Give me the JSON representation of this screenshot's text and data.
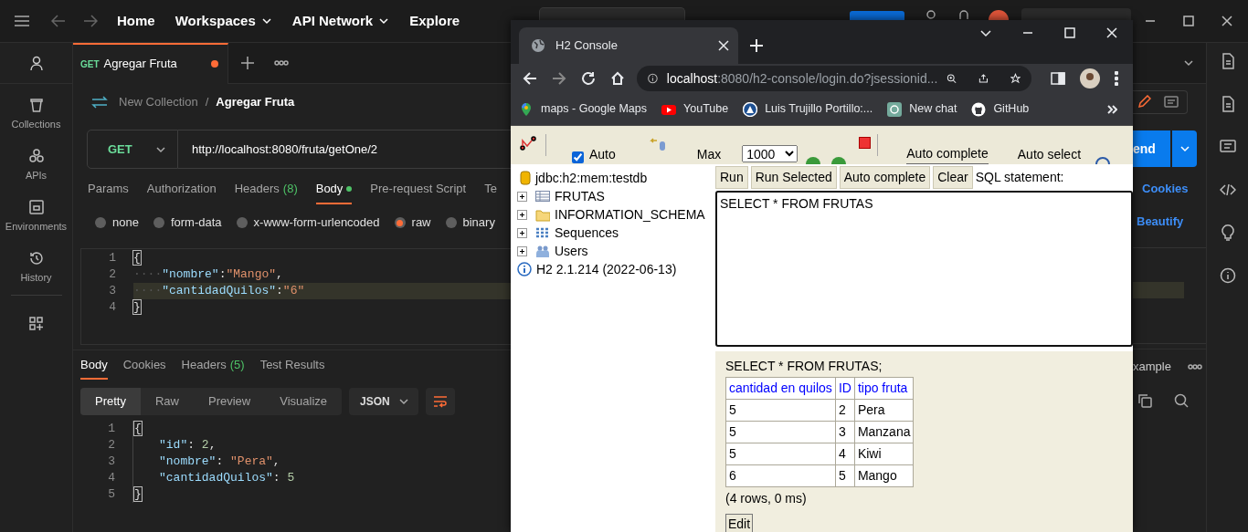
{
  "app_bar": {
    "nav": [
      {
        "label": "Home",
        "dropdown": false
      },
      {
        "label": "Workspaces",
        "dropdown": true
      },
      {
        "label": "API Network",
        "dropdown": true
      },
      {
        "label": "Explore",
        "dropdown": false
      }
    ]
  },
  "sidebar": [
    {
      "kind": "account"
    },
    {
      "kind": "collections",
      "label": "Collections"
    },
    {
      "kind": "apis",
      "label": "APIs"
    },
    {
      "kind": "environments",
      "label": "Environments"
    },
    {
      "kind": "history",
      "label": "History"
    },
    {
      "kind": "add-apps"
    }
  ],
  "request_tab": {
    "method": "GET",
    "title": "Agregar Fruta",
    "unsaved": true
  },
  "breadcrumb": {
    "collection": "New Collection",
    "separator": "/",
    "request": "Agregar Fruta"
  },
  "request": {
    "method": "GET",
    "url": "http://localhost:8080/fruta/getOne/2",
    "send_label": "end"
  },
  "request_tabs": [
    {
      "label": "Params",
      "selected": false
    },
    {
      "label": "Authorization",
      "selected": false
    },
    {
      "label": "Headers",
      "count": "(8)",
      "selected": false
    },
    {
      "label": "Body",
      "selected": true,
      "has_content": true
    },
    {
      "label": "Pre-request Script",
      "selected": false
    },
    {
      "label": "Te",
      "selected": false
    }
  ],
  "cookies_link": "Cookies",
  "body_types": [
    {
      "label": "none",
      "selected": false
    },
    {
      "label": "form-data",
      "selected": false
    },
    {
      "label": "x-www-form-urlencoded",
      "selected": false
    },
    {
      "label": "raw",
      "selected": true
    },
    {
      "label": "binary",
      "selected": false
    }
  ],
  "beautify_link": "Beautify",
  "request_body": [
    {
      "n": "1",
      "current": false,
      "tokens": [
        {
          "kind": "brace",
          "text": "{"
        }
      ]
    },
    {
      "n": "2",
      "current": false,
      "tokens": [
        {
          "kind": "ws",
          "text": "····"
        },
        {
          "kind": "key",
          "text": "\"nombre\""
        },
        {
          "kind": "punct",
          "text": ":"
        },
        {
          "kind": "str",
          "text": "\"Mango\""
        },
        {
          "kind": "punct",
          "text": ","
        }
      ]
    },
    {
      "n": "3",
      "current": true,
      "tokens": [
        {
          "kind": "ws",
          "text": "····"
        },
        {
          "kind": "key",
          "text": "\"cantidadQuilos\""
        },
        {
          "kind": "punct",
          "text": ":"
        },
        {
          "kind": "str",
          "text": "\"6\""
        }
      ]
    },
    {
      "n": "4",
      "current": false,
      "tokens": [
        {
          "kind": "brace",
          "text": "}"
        }
      ]
    }
  ],
  "response_tabs": [
    {
      "label": "Body",
      "selected": true
    },
    {
      "label": "Cookies",
      "selected": false
    },
    {
      "label": "Headers",
      "count": "(5)",
      "selected": false
    },
    {
      "label": "Test Results",
      "selected": false
    }
  ],
  "view_modes": [
    {
      "label": "Pretty",
      "selected": true
    },
    {
      "label": "Raw",
      "selected": false
    },
    {
      "label": "Preview",
      "selected": false
    },
    {
      "label": "Visualize",
      "selected": false
    }
  ],
  "format": "JSON",
  "save_example": "xample",
  "response_body": [
    {
      "n": "1",
      "indented": false,
      "tokens": [
        {
          "kind": "brace",
          "text": "{"
        }
      ]
    },
    {
      "n": "2",
      "indented": true,
      "tokens": [
        {
          "kind": "key",
          "text": "\"id\""
        },
        {
          "kind": "punct",
          "text": ": "
        },
        {
          "kind": "num",
          "text": "2"
        },
        {
          "kind": "punct",
          "text": ","
        }
      ]
    },
    {
      "n": "3",
      "indented": true,
      "tokens": [
        {
          "kind": "key",
          "text": "\"nombre\""
        },
        {
          "kind": "punct",
          "text": ": "
        },
        {
          "kind": "str",
          "text": "\"Pera\""
        },
        {
          "kind": "punct",
          "text": ","
        }
      ]
    },
    {
      "n": "4",
      "indented": true,
      "tokens": [
        {
          "kind": "key",
          "text": "\"cantidadQuilos\""
        },
        {
          "kind": "punct",
          "text": ": "
        },
        {
          "kind": "num",
          "text": "5"
        }
      ]
    },
    {
      "n": "5",
      "indented": false,
      "tokens": [
        {
          "kind": "brace",
          "text": "}"
        }
      ]
    }
  ],
  "browser": {
    "tab_title": "H2 Console",
    "url_host": "localhost",
    "url_rest": ":8080/h2-console/login.do?jsessionid...",
    "bookmarks": [
      {
        "kind": "maps",
        "label": "maps - Google Maps"
      },
      {
        "kind": "youtube",
        "label": "YouTube"
      },
      {
        "kind": "badge",
        "label": "Luis Trujillo Portillo:..."
      },
      {
        "kind": "chat",
        "label": "New chat"
      },
      {
        "kind": "github",
        "label": "GitHub"
      }
    ],
    "h2": {
      "auto_commit": {
        "label": "Auto",
        "checked": true
      },
      "max_label": "Max",
      "max_rows": "1000",
      "auto_complete_label": "Auto complete",
      "auto_select_label": "Auto select",
      "tree": [
        {
          "kind": "database",
          "label": "jdbc:h2:mem:testdb"
        },
        {
          "kind": "table",
          "label": "FRUTAS",
          "expanded": false
        },
        {
          "kind": "folder",
          "label": "INFORMATION_SCHEMA",
          "expanded": false
        },
        {
          "kind": "sequences",
          "label": "Sequences",
          "expanded": false
        },
        {
          "kind": "users",
          "label": "Users",
          "expanded": false
        },
        {
          "kind": "info",
          "label": "H2 2.1.214 (2022-06-13)"
        }
      ],
      "buttons": [
        "Run",
        "Run Selected",
        "Auto complete",
        "Clear"
      ],
      "sql_label": "SQL statement:",
      "sql": "SELECT * FROM FRUTAS",
      "result": {
        "statement": "SELECT * FROM FRUTAS;",
        "columns": [
          "cantidad en quilos",
          "ID",
          "tipo fruta"
        ],
        "rows": [
          [
            "5",
            "2",
            "Pera"
          ],
          [
            "5",
            "3",
            "Manzana"
          ],
          [
            "5",
            "4",
            "Kiwi"
          ],
          [
            "6",
            "5",
            "Mango"
          ]
        ],
        "summary": "(4 rows, 0 ms)",
        "edit_button": "Edit"
      }
    }
  }
}
